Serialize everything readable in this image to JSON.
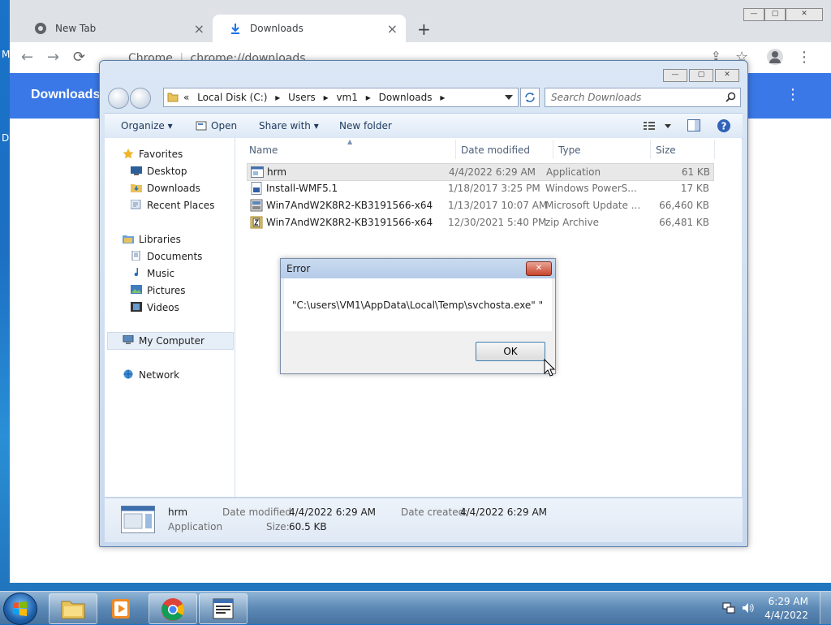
{
  "desktop": {
    "frag_m": "M",
    "frag_d": "D"
  },
  "chrome": {
    "tabs": [
      {
        "label": "New Tab",
        "close": "×"
      },
      {
        "label": "Downloads",
        "close": "×"
      }
    ],
    "new_tab": "+",
    "back": "←",
    "forward": "→",
    "reload": "⟳",
    "omnibox_site": "Chrome",
    "omnibox_separator": "|",
    "omnibox_url": "chrome://downloads",
    "share": "⇪",
    "star": "☆",
    "menu": "⋮",
    "window_controls": {
      "minimize": "—",
      "maximize": "▢",
      "close": "✕"
    },
    "header_title": "Downloads",
    "header_menu": "⋮"
  },
  "explorer": {
    "window_controls": {
      "minimize": "—",
      "maximize": "▢",
      "close": "✕"
    },
    "breadcrumb": {
      "prefix": "«",
      "items": [
        "Local Disk (C:)",
        "Users",
        "vm1",
        "Downloads"
      ],
      "sep": "▸"
    },
    "search_placeholder": "Search Downloads",
    "toolbar": {
      "organize": "Organize ▾",
      "open": "Open",
      "share_with": "Share with ▾",
      "new_folder": "New folder"
    },
    "nav": {
      "favorites": "Favorites",
      "desktop": "Desktop",
      "downloads": "Downloads",
      "recent": "Recent Places",
      "libraries": "Libraries",
      "documents": "Documents",
      "music": "Music",
      "pictures": "Pictures",
      "videos": "Videos",
      "my_computer": "My Computer",
      "network": "Network"
    },
    "columns": {
      "name": "Name",
      "date": "Date modified",
      "type": "Type",
      "size": "Size"
    },
    "files": [
      {
        "name": "hrm",
        "date": "4/4/2022 6:29 AM",
        "type": "Application",
        "size": "61 KB"
      },
      {
        "name": "Install-WMF5.1",
        "date": "1/18/2017 3:25 PM",
        "type": "Windows PowerS...",
        "size": "17 KB"
      },
      {
        "name": "Win7AndW2K8R2-KB3191566-x64",
        "date": "1/13/2017 10:07 AM",
        "type": "Microsoft Update ...",
        "size": "66,460 KB"
      },
      {
        "name": "Win7AndW2K8R2-KB3191566-x64",
        "date": "12/30/2021 5:40 PM",
        "type": "zip Archive",
        "size": "66,481 KB"
      }
    ],
    "details": {
      "name": "hrm",
      "kind": "Application",
      "date_modified_label": "Date modified:",
      "date_modified": "4/4/2022 6:29 AM",
      "size_label": "Size:",
      "size": "60.5 KB",
      "date_created_label": "Date created:",
      "date_created": "4/4/2022 6:29 AM"
    }
  },
  "dialog": {
    "title": "Error",
    "message": "\"C:\\users\\VM1\\AppData\\Local\\Temp\\svchosta.exe\"  \"",
    "ok": "OK",
    "close": "✕"
  },
  "taskbar": {
    "clock_time": "6:29 AM",
    "clock_date": "4/4/2022"
  }
}
